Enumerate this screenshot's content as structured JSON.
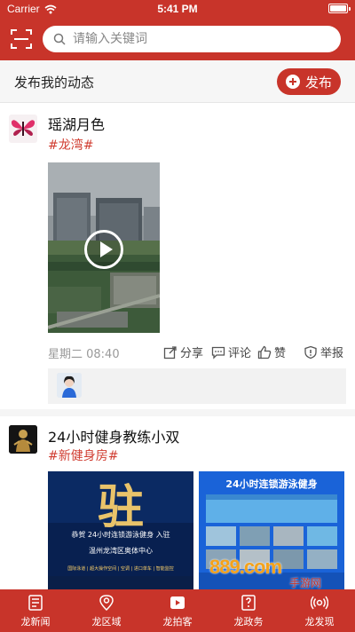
{
  "status_bar": {
    "carrier": "Carrier",
    "time": "5:41 PM"
  },
  "search": {
    "placeholder": "请输入关键词"
  },
  "post_bar": {
    "title": "发布我的动态",
    "publish_label": "发布"
  },
  "posts": [
    {
      "username": "瑶湖月色",
      "topic": "#龙湾#",
      "time": "星期二 08:40",
      "actions": {
        "share": "分享",
        "comment": "评论",
        "like": "赞",
        "report": "举报"
      }
    },
    {
      "username": "24小时健身教练小双",
      "topic": "#新健身房#",
      "posters": [
        {
          "big_text": "驻",
          "line1": "恭贺 24小时连锁游泳健身 入驻",
          "line2": "温州龙湾区奥体中心",
          "line3": "国际泳道 | 超大操作空间 | 空调 | 进口单车 | 智能监控"
        },
        {
          "title": "24小时连锁游泳健身"
        }
      ]
    }
  ],
  "watermark": {
    "main": "889.com",
    "sub": "手游网"
  },
  "tabs": [
    {
      "label": "龙新闻",
      "icon": "news-icon"
    },
    {
      "label": "龙区域",
      "icon": "location-icon"
    },
    {
      "label": "龙拍客",
      "icon": "video-icon"
    },
    {
      "label": "龙政务",
      "icon": "government-icon"
    },
    {
      "label": "龙发现",
      "icon": "discover-icon"
    }
  ],
  "colors": {
    "brand_red": "#c8342a",
    "topic_red": "#d03c30"
  }
}
